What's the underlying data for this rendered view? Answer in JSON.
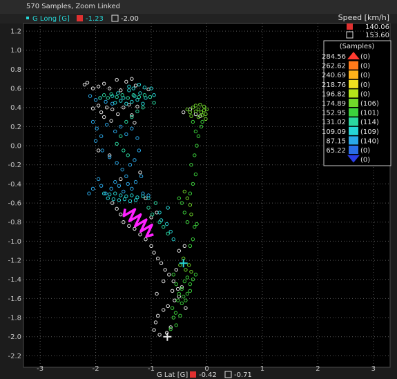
{
  "header": {
    "samples_text": "570 Samples, Zoom Linked",
    "cursor_a_value": "-1.23",
    "cursor_b_value": "-2.00"
  },
  "footer": {
    "x_axis_label": "G Lat [G]",
    "cursor_a_value": "-0.42",
    "cursor_b_value": "-0.71"
  },
  "legend": {
    "speed_title": "Speed [km/h]",
    "cursor_a_speed": "140.06",
    "cursor_b_speed": "153.60",
    "histogram_title": "(Samples)",
    "bins": [
      {
        "speed": "284.56",
        "count": "(0)",
        "color": "#ff3b30"
      },
      {
        "speed": "262.62",
        "count": "(0)",
        "color": "#ff7a1a"
      },
      {
        "speed": "240.69",
        "count": "(0)",
        "color": "#ffb21a"
      },
      {
        "speed": "218.76",
        "count": "(0)",
        "color": "#f0e020"
      },
      {
        "speed": "196.82",
        "count": "(0)",
        "color": "#b5e61a"
      },
      {
        "speed": "174.89",
        "count": "(106)",
        "color": "#70d82a"
      },
      {
        "speed": "152.95",
        "count": "(101)",
        "color": "#3cd23c"
      },
      {
        "speed": "131.02",
        "count": "(114)",
        "color": "#2bd8a0"
      },
      {
        "speed": "109.09",
        "count": "(109)",
        "color": "#26d6d6"
      },
      {
        "speed": "87.15",
        "count": "(140)",
        "color": "#2aa8e8"
      },
      {
        "speed": "65.22",
        "count": "(0)",
        "color": "#2a6ee8"
      },
      {
        "speed": "",
        "count": "(0)",
        "color": "#2a3ee8"
      }
    ]
  },
  "chart_data": {
    "type": "scatter",
    "title": "",
    "xlabel": "G Lat [G]",
    "ylabel": "G Long [G]",
    "xlim": [
      -3.3,
      3.3
    ],
    "ylim": [
      -2.32,
      1.28
    ],
    "x_ticks": [
      -3,
      -2,
      -1,
      0,
      1,
      2,
      3
    ],
    "y_ticks": [
      1.2,
      1.0,
      0.8,
      0.6,
      0.4,
      0.2,
      0.0,
      -0.2,
      -0.4,
      -0.6,
      -0.8,
      -1.0,
      -1.2,
      -1.4,
      -1.6,
      -1.8,
      -2.0,
      -2.2
    ],
    "x_tick_labels": [
      "-3",
      "-2",
      "-1",
      "0",
      "1",
      "2",
      "3"
    ],
    "y_tick_labels": [
      "1.2",
      "1.0",
      "0.8",
      "0.6",
      "0.4",
      "0.2",
      "0.0",
      "-0.2",
      "-0.4",
      "-0.6",
      "-0.8",
      "-1.0",
      "-1.2",
      "-1.4",
      "-1.6",
      "-1.8",
      "-2.0",
      "-2.2"
    ],
    "grid": true,
    "colors": {
      "white": "#e8e8e8",
      "blue": "#2aa8e8",
      "cyan": "#26d6d6",
      "teal": "#2bd8a0",
      "green": "#3cd23c",
      "lime": "#70d82a",
      "magenta": "#ff20ff"
    },
    "series": [
      {
        "color_key": "white",
        "points": [
          [
            -2.2,
            0.64
          ],
          [
            -2.15,
            0.66
          ],
          [
            -2.05,
            0.6
          ],
          [
            -1.95,
            0.62
          ],
          [
            -1.85,
            0.65
          ],
          [
            -1.75,
            0.6
          ],
          [
            -1.62,
            0.69
          ],
          [
            -1.55,
            0.58
          ],
          [
            -1.45,
            0.67
          ],
          [
            -1.35,
            0.7
          ],
          [
            -1.28,
            0.63
          ],
          [
            -1.05,
            0.59
          ],
          [
            -1.95,
            0.42
          ],
          [
            -2.05,
            0.39
          ],
          [
            -1.9,
            0.35
          ],
          [
            -1.8,
            0.4
          ],
          [
            -1.7,
            0.38
          ],
          [
            -1.6,
            0.33
          ],
          [
            -1.5,
            0.4
          ],
          [
            -1.4,
            0.43
          ],
          [
            -1.35,
            0.32
          ],
          [
            -1.25,
            0.41
          ],
          [
            -1.85,
            0.3
          ],
          [
            -1.72,
            0.26
          ],
          [
            -1.3,
            0.24
          ],
          [
            -1.95,
            -0.05
          ],
          [
            -1.75,
            -0.1
          ],
          [
            -1.55,
            -0.35
          ],
          [
            -1.2,
            -0.28
          ],
          [
            -1.1,
            -0.55
          ],
          [
            -1.7,
            -0.6
          ],
          [
            -1.62,
            -0.66
          ],
          [
            -1.55,
            -0.72
          ],
          [
            -1.5,
            -0.8
          ],
          [
            -1.4,
            -0.84
          ],
          [
            -1.3,
            -0.87
          ],
          [
            -1.2,
            -0.93
          ],
          [
            -1.1,
            -0.98
          ],
          [
            -1.0,
            -1.05
          ],
          [
            -0.95,
            -1.12
          ],
          [
            -0.88,
            -1.18
          ],
          [
            -0.82,
            -1.23
          ],
          [
            -0.75,
            -1.3
          ],
          [
            -0.68,
            -1.35
          ],
          [
            -0.6,
            -1.42
          ],
          [
            -0.52,
            -1.5
          ],
          [
            -0.5,
            -1.58
          ],
          [
            -0.58,
            -1.62
          ],
          [
            -0.7,
            -1.68
          ],
          [
            -0.78,
            -1.72
          ],
          [
            -0.88,
            -1.78
          ],
          [
            -0.92,
            -1.85
          ],
          [
            -0.95,
            -1.93
          ],
          [
            -0.85,
            -1.98
          ],
          [
            -0.72,
            -1.96
          ],
          [
            -0.65,
            -1.9
          ],
          [
            -1.0,
            -0.75
          ],
          [
            -0.9,
            -0.7
          ],
          [
            -0.42,
            0.35
          ],
          [
            -0.3,
            0.38
          ],
          [
            -0.2,
            0.33
          ],
          [
            -0.12,
            0.31
          ],
          [
            -0.5,
            -1.1
          ],
          [
            -0.4,
            -1.05
          ],
          [
            -0.55,
            -1.3
          ],
          [
            -0.78,
            -1.42
          ],
          [
            -0.62,
            -1.52
          ],
          [
            -0.45,
            -1.48
          ],
          [
            -0.38,
            -1.7
          ],
          [
            -0.9,
            -1.55
          ]
        ]
      },
      {
        "color_key": "blue",
        "points": [
          [
            -2.1,
            0.52
          ],
          [
            -2.0,
            0.48
          ],
          [
            -1.92,
            0.5
          ],
          [
            -1.82,
            0.46
          ],
          [
            -1.7,
            0.44
          ],
          [
            -2.05,
            0.25
          ],
          [
            -1.98,
            0.18
          ],
          [
            -1.9,
            0.1
          ],
          [
            -1.8,
            0.22
          ],
          [
            -1.65,
            0.15
          ],
          [
            -1.55,
            0.2
          ],
          [
            -1.45,
            0.12
          ],
          [
            -1.35,
            0.18
          ],
          [
            -1.25,
            0.08
          ],
          [
            -2.0,
            0.05
          ],
          [
            -1.88,
            -0.05
          ],
          [
            -1.75,
            -0.12
          ],
          [
            -1.62,
            -0.18
          ],
          [
            -1.52,
            -0.25
          ],
          [
            -1.45,
            -0.32
          ],
          [
            -1.38,
            -0.2
          ],
          [
            -1.3,
            -0.15
          ],
          [
            -1.22,
            -0.05
          ],
          [
            -1.18,
            -0.32
          ],
          [
            -1.95,
            -0.35
          ],
          [
            -1.9,
            -0.42
          ],
          [
            -1.82,
            -0.5
          ],
          [
            -1.72,
            -0.45
          ],
          [
            -2.05,
            -0.45
          ],
          [
            -2.12,
            -0.5
          ],
          [
            -1.65,
            -0.38
          ],
          [
            -1.58,
            -0.42
          ],
          [
            -1.5,
            -0.48
          ],
          [
            -1.42,
            -0.4
          ],
          [
            -1.35,
            -0.45
          ],
          [
            -1.28,
            -0.38
          ],
          [
            -1.15,
            -0.5
          ],
          [
            -1.05,
            -0.52
          ]
        ]
      },
      {
        "color_key": "cyan",
        "points": [
          [
            -1.85,
            -0.5
          ],
          [
            -1.75,
            -0.51
          ],
          [
            -1.65,
            -0.5
          ],
          [
            -1.55,
            -0.52
          ],
          [
            -1.45,
            -0.53
          ],
          [
            -1.35,
            -0.52
          ],
          [
            -1.25,
            -0.54
          ],
          [
            -1.15,
            -0.53
          ],
          [
            -1.05,
            -0.55
          ],
          [
            -1.78,
            -0.55
          ],
          [
            -1.68,
            -0.56
          ],
          [
            -1.58,
            -0.57
          ],
          [
            -1.48,
            -0.56
          ],
          [
            -1.38,
            -0.58
          ],
          [
            -1.28,
            -0.57
          ],
          [
            -1.7,
            0.52
          ],
          [
            -1.6,
            0.55
          ],
          [
            -1.5,
            0.5
          ],
          [
            -1.4,
            0.58
          ],
          [
            -1.3,
            0.52
          ],
          [
            -1.2,
            0.55
          ],
          [
            -1.1,
            0.5
          ],
          [
            -1.65,
            0.45
          ],
          [
            -1.55,
            0.47
          ],
          [
            -1.45,
            0.44
          ],
          [
            -1.35,
            0.46
          ],
          [
            -1.25,
            0.48
          ],
          [
            -1.15,
            0.44
          ],
          [
            -1.4,
            0.62
          ],
          [
            -1.32,
            0.6
          ],
          [
            -1.22,
            0.64
          ],
          [
            -1.12,
            0.61
          ],
          [
            -1.0,
            0.6
          ],
          [
            -0.95,
            0.53
          ],
          [
            -0.85,
            -0.7
          ],
          [
            -0.82,
            -0.78
          ],
          [
            -0.72,
            -0.82
          ],
          [
            -0.7,
            -0.65
          ],
          [
            -0.65,
            -0.9
          ],
          [
            -0.6,
            -0.98
          ]
        ]
      },
      {
        "color_key": "teal",
        "points": [
          [
            -1.92,
            0.5
          ],
          [
            -1.85,
            0.53
          ],
          [
            -1.78,
            0.5
          ],
          [
            -1.72,
            0.54
          ],
          [
            -1.62,
            0.51
          ],
          [
            -1.52,
            0.53
          ],
          [
            -1.42,
            0.5
          ],
          [
            -1.32,
            0.53
          ],
          [
            -1.22,
            0.51
          ],
          [
            -1.12,
            0.53
          ],
          [
            -1.02,
            0.51
          ],
          [
            -0.95,
            0.45
          ],
          [
            -1.15,
            0.4
          ],
          [
            -1.25,
            0.36
          ],
          [
            -1.35,
            0.3
          ],
          [
            -1.45,
            0.25
          ],
          [
            -1.55,
            0.1
          ],
          [
            -1.62,
            0.02
          ],
          [
            -1.5,
            -0.05
          ],
          [
            -1.42,
            -0.1
          ],
          [
            -1.05,
            -0.65
          ],
          [
            -0.98,
            -0.72
          ],
          [
            -0.92,
            -0.6
          ],
          [
            -0.85,
            -0.8
          ],
          [
            -0.78,
            -0.85
          ],
          [
            -0.7,
            -0.92
          ]
        ]
      },
      {
        "color_key": "green",
        "points": [
          [
            -0.45,
            -1.5
          ],
          [
            -0.4,
            -1.42
          ],
          [
            -0.35,
            -1.38
          ],
          [
            -0.3,
            -1.45
          ],
          [
            -0.25,
            -1.4
          ],
          [
            -0.2,
            -1.35
          ],
          [
            -0.55,
            -1.45
          ],
          [
            -0.6,
            -1.35
          ],
          [
            -0.5,
            -1.55
          ],
          [
            -0.42,
            -1.58
          ],
          [
            -0.35,
            -1.55
          ],
          [
            -0.3,
            -1.52
          ],
          [
            -0.52,
            -1.62
          ],
          [
            -0.45,
            -1.65
          ],
          [
            -0.38,
            -1.62
          ],
          [
            -0.62,
            -1.7
          ],
          [
            -0.56,
            -1.75
          ],
          [
            -0.48,
            -1.78
          ],
          [
            -0.6,
            -1.8
          ],
          [
            -0.55,
            -1.88
          ],
          [
            -0.65,
            -1.92
          ],
          [
            -0.3,
            -1.05
          ],
          [
            -0.25,
            -0.98
          ],
          [
            -0.22,
            -0.85
          ],
          [
            -0.18,
            -0.82
          ],
          [
            -0.35,
            -0.8
          ],
          [
            -0.4,
            -0.7
          ],
          [
            -0.45,
            -0.6
          ],
          [
            -0.5,
            -0.55
          ],
          [
            -0.3,
            -0.5
          ],
          [
            -0.25,
            -0.4
          ],
          [
            -0.2,
            -0.3
          ],
          [
            -0.28,
            -0.2
          ],
          [
            -0.22,
            -0.1
          ],
          [
            -0.18,
            0.0
          ],
          [
            -0.15,
            0.1
          ],
          [
            -0.1,
            0.2
          ],
          [
            -0.08,
            0.25
          ],
          [
            -0.25,
            0.25
          ],
          [
            -0.2,
            0.15
          ]
        ]
      },
      {
        "color_key": "lime",
        "points": [
          [
            -0.35,
            0.38
          ],
          [
            -0.3,
            0.35
          ],
          [
            -0.25,
            0.4
          ],
          [
            -0.2,
            0.36
          ],
          [
            -0.15,
            0.38
          ],
          [
            -0.1,
            0.35
          ],
          [
            -0.05,
            0.37
          ],
          [
            -0.02,
            0.33
          ],
          [
            0.0,
            0.38
          ],
          [
            -0.05,
            0.41
          ],
          [
            -0.12,
            0.43
          ],
          [
            -0.2,
            0.42
          ],
          [
            -0.28,
            0.31
          ],
          [
            -0.15,
            0.3
          ],
          [
            -0.08,
            0.32
          ],
          [
            -0.02,
            0.28
          ],
          [
            -0.3,
            -0.62
          ],
          [
            -0.35,
            -0.55
          ],
          [
            -0.28,
            -0.72
          ],
          [
            -0.4,
            -0.48
          ],
          [
            -0.48,
            -1.25
          ],
          [
            -0.42,
            -1.18
          ],
          [
            -0.38,
            -1.3
          ],
          [
            -0.32,
            -1.25
          ],
          [
            -0.28,
            -1.32
          ]
        ]
      }
    ],
    "annotations": [
      {
        "type": "oscillation",
        "color": "magenta",
        "from": [
          -1.47,
          -0.66
        ],
        "to": [
          -0.96,
          -0.93
        ]
      },
      {
        "type": "cursor_marker",
        "color": "cyan",
        "at": [
          -0.42,
          -1.23
        ]
      },
      {
        "type": "cursor_marker",
        "color": "white",
        "at": [
          -0.71,
          -2.0
        ]
      }
    ]
  }
}
